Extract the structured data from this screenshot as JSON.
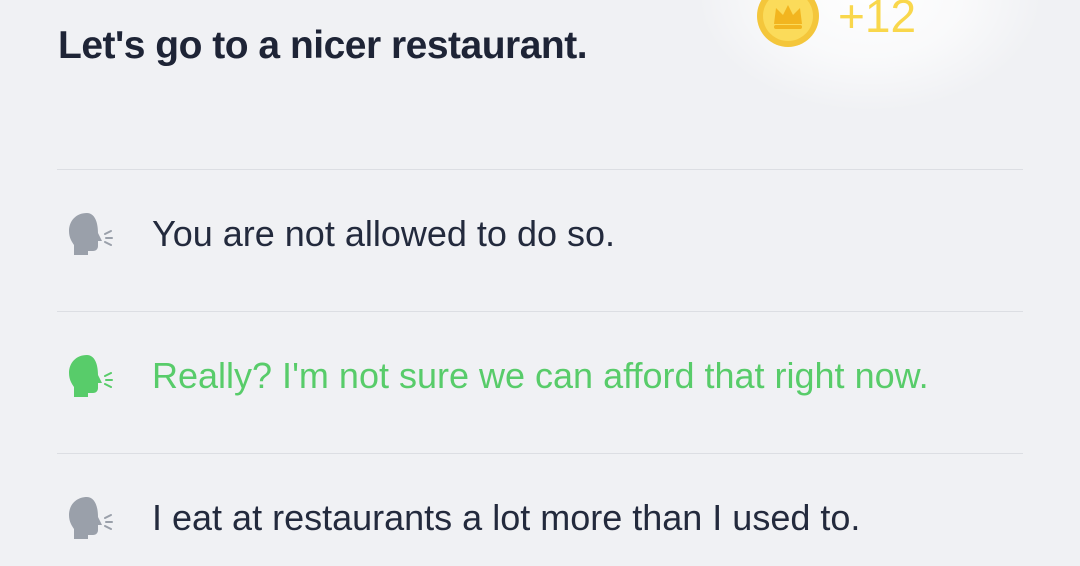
{
  "prompt": "Let's go to a nicer restaurant.",
  "reward": {
    "amount": "+12",
    "icon": "crown-coin-icon",
    "color": "#f9d74c"
  },
  "options": [
    {
      "text": "You are not allowed to do so.",
      "icon": "speaking-head-icon",
      "state": "default",
      "color": "#9aa0aa"
    },
    {
      "text": "Really? I'm not sure we can afford that right now.",
      "icon": "speaking-head-icon",
      "state": "correct",
      "color": "#58cc6a"
    },
    {
      "text": "I eat at restaurants a lot more than I used to.",
      "icon": "speaking-head-icon",
      "state": "default",
      "color": "#9aa0aa"
    }
  ]
}
